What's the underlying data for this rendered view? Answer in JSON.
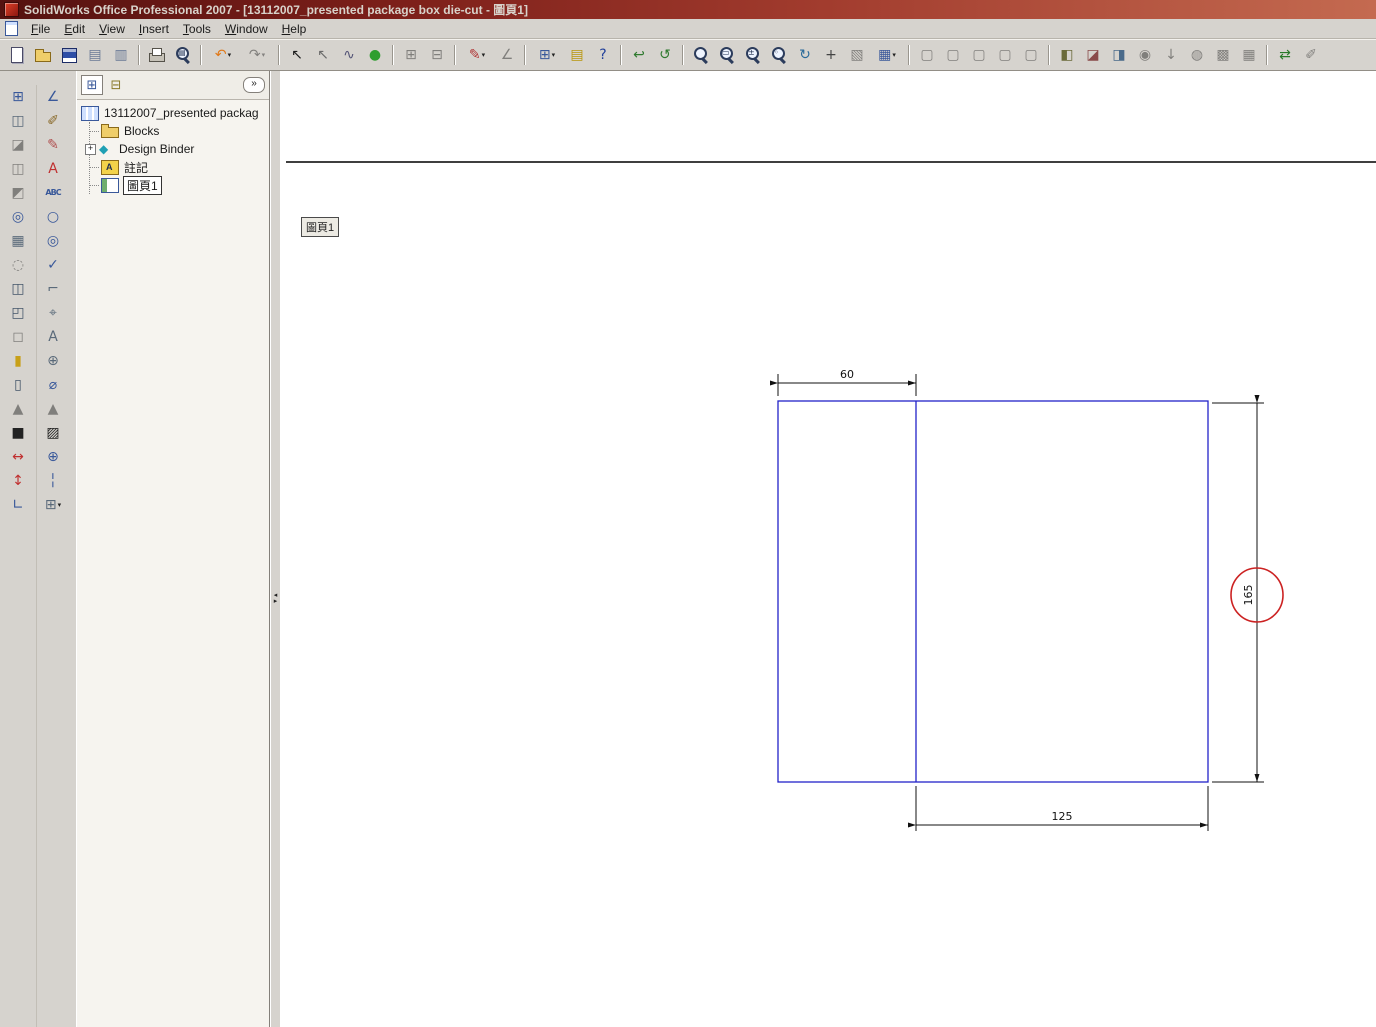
{
  "titlebar": {
    "title": "SolidWorks Office Professional 2007 - [13112007_presented package box die-cut - 圖頁1]"
  },
  "menu": {
    "items": [
      "File",
      "Edit",
      "View",
      "Insert",
      "Tools",
      "Window",
      "Help"
    ]
  },
  "ui": {
    "dropdown_glyph": "▾",
    "panel_more": "»",
    "tab_feature_glyph": "⊞",
    "tab_property_glyph": "⊟",
    "splitter_left": "◂",
    "splitter_right": "▸",
    "expander_plus": "+"
  },
  "toolbars": {
    "main": [
      {
        "name": "new-document-button",
        "shape": "page"
      },
      {
        "name": "open-button",
        "shape": "folder"
      },
      {
        "name": "save-button",
        "shape": "floppy"
      },
      {
        "name": "make-drawing-from-part-button",
        "glyph": "▤",
        "color": "#6a7a96"
      },
      {
        "name": "make-assembly-from-part-button",
        "glyph": "▥",
        "color": "#6a7a96"
      },
      {
        "sep": true
      },
      {
        "name": "print-button",
        "shape": "printer"
      },
      {
        "name": "print-preview-button",
        "shape": "mag",
        "sub": "▤"
      },
      {
        "sep": true
      },
      {
        "name": "undo-button",
        "glyph": "↶",
        "color": "#e07818",
        "dropdown": true
      },
      {
        "name": "redo-button",
        "glyph": "↷",
        "enabled": false,
        "dropdown": true
      },
      {
        "sep": true
      },
      {
        "name": "select-button",
        "glyph": "↖",
        "color": "#1a1a1a"
      },
      {
        "name": "select-other-button",
        "glyph": "↖",
        "color": "#6a6a6a"
      },
      {
        "name": "lasso-select-button",
        "glyph": "∿",
        "color": "#555577"
      },
      {
        "name": "selection-filter-button",
        "glyph": "●",
        "color": "#2f9e2f"
      },
      {
        "sep": true
      },
      {
        "name": "grid-settings-button",
        "glyph": "⊞",
        "enabled": false
      },
      {
        "name": "snap-settings-button",
        "glyph": "⊟",
        "enabled": false
      },
      {
        "sep": true
      },
      {
        "name": "sketch-button",
        "glyph": "✎",
        "color": "#b03838",
        "dropdown": true
      },
      {
        "name": "smart-dimension-button",
        "glyph": "∠",
        "enabled": false
      },
      {
        "sep": true
      },
      {
        "name": "tables-button",
        "glyph": "⊞",
        "color": "#39589a",
        "dropdown": true
      },
      {
        "name": "note-button",
        "glyph": "▤",
        "color": "#b8960c"
      },
      {
        "name": "help-button",
        "glyph": "?",
        "color": "#22409a"
      },
      {
        "sep": true
      },
      {
        "name": "undo-view-button",
        "glyph": "↩",
        "color": "#2f7a2f"
      },
      {
        "name": "redraw-button",
        "glyph": "↺",
        "color": "#2f7a2f"
      },
      {
        "sep": true
      },
      {
        "name": "zoom-to-fit-button",
        "shape": "mag"
      },
      {
        "name": "zoom-to-area-button",
        "shape": "mag",
        "sub": "▭"
      },
      {
        "name": "zoom-in-out-button",
        "shape": "mag",
        "sub": "±"
      },
      {
        "name": "zoom-to-selection-button",
        "shape": "mag",
        "sub": "◦"
      },
      {
        "name": "rotate-view-button",
        "glyph": "↻",
        "color": "#2a6a9a"
      },
      {
        "name": "pan-button",
        "glyph": "+",
        "color": "#444444"
      },
      {
        "name": "3d-drawing-view-button",
        "glyph": "▧",
        "enabled": false
      },
      {
        "name": "view-orientation-button",
        "glyph": "▦",
        "color": "#39589a",
        "dropdown": true
      },
      {
        "sep": true
      },
      {
        "name": "wireframe-button",
        "glyph": "▢",
        "enabled": false
      },
      {
        "name": "hidden-lines-visible-button",
        "glyph": "▢",
        "enabled": false
      },
      {
        "name": "hidden-lines-removed-button",
        "glyph": "▢",
        "enabled": false
      },
      {
        "name": "shaded-with-edges-button",
        "glyph": "▢",
        "enabled": false
      },
      {
        "name": "shaded-button",
        "glyph": "▢",
        "enabled": false
      },
      {
        "sep": true
      },
      {
        "name": "shadows-button",
        "glyph": "◧",
        "color": "#6a6a3a"
      },
      {
        "name": "section-view-display-button",
        "glyph": "◪",
        "color": "#8a4a4a"
      },
      {
        "name": "curvature-button",
        "glyph": "◨",
        "color": "#4a6a8a"
      },
      {
        "name": "camera-view-button",
        "glyph": "◉",
        "enabled": false
      },
      {
        "name": "apply-scene-button",
        "glyph": "↓",
        "enabled": false
      },
      {
        "name": "realview-button",
        "glyph": "◍",
        "enabled": false
      },
      {
        "name": "draft-quality-button",
        "glyph": "▩",
        "enabled": false
      },
      {
        "name": "large-assembly-mode-button",
        "glyph": "▦",
        "enabled": false
      },
      {
        "sep": true
      },
      {
        "name": "hyperlink-button",
        "glyph": "⇄",
        "color": "#2a7a2a"
      },
      {
        "name": "comment-button",
        "glyph": "✐",
        "enabled": false
      }
    ],
    "left1": [
      {
        "name": "model-view-button",
        "glyph": "⊞",
        "color": "#39589a"
      },
      {
        "name": "projected-view-button",
        "glyph": "◫",
        "color": "#5a6a7a"
      },
      {
        "name": "auxiliary-view-button",
        "glyph": "◪",
        "enabled": false
      },
      {
        "name": "section-view-button",
        "glyph": "◫",
        "enabled": false
      },
      {
        "name": "aligned-section-view-button",
        "glyph": "◩",
        "enabled": false
      },
      {
        "name": "detail-view-button",
        "glyph": "◎",
        "color": "#39589a"
      },
      {
        "name": "standard-3-view-button",
        "glyph": "▦",
        "color": "#5a6a7a"
      },
      {
        "name": "broken-out-section-button",
        "glyph": "◌",
        "enabled": false
      },
      {
        "name": "break-view-button",
        "glyph": "◫",
        "color": "#44566a"
      },
      {
        "name": "crop-view-button",
        "glyph": "◰",
        "color": "#44566a"
      },
      {
        "name": "alternate-position-view-button",
        "glyph": "◻",
        "enabled": false
      },
      {
        "name": "update-view-button",
        "glyph": "▮",
        "color": "#c8a018"
      },
      {
        "name": "empty-view-button",
        "glyph": "▯",
        "color": "#44566a"
      },
      {
        "name": "rebuild-warning-icon",
        "glyph": "▲",
        "enabled": false
      },
      {
        "name": "area-fill-button",
        "glyph": "■",
        "color": "#222222"
      },
      {
        "name": "horizontal-dimension-button",
        "glyph": "↔",
        "color": "#c03030"
      },
      {
        "name": "vertical-dimension-button",
        "glyph": "↕",
        "color": "#c03030"
      },
      {
        "name": "ordinate-dimension-button",
        "glyph": "∟",
        "color": "#39589a"
      }
    ],
    "left2": [
      {
        "name": "smart-dimension-button",
        "glyph": "∠",
        "color": "#39589a"
      },
      {
        "name": "format-painter-button",
        "glyph": "✐",
        "color": "#8a6a2a"
      },
      {
        "name": "dimension-style-button",
        "glyph": "✎",
        "color": "#b05050"
      },
      {
        "name": "note-button",
        "glyph": "A",
        "color": "#c03030"
      },
      {
        "name": "spell-checker-button",
        "glyph": "ABC",
        "color": "#39589a"
      },
      {
        "name": "balloon-button",
        "glyph": "○",
        "color": "#39589a"
      },
      {
        "name": "auto-balloon-button",
        "glyph": "◎",
        "color": "#39589a"
      },
      {
        "name": "surface-finish-button",
        "glyph": "✓",
        "color": "#39589a"
      },
      {
        "name": "weld-symbol-button",
        "glyph": "⌐",
        "color": "#5a6a7a"
      },
      {
        "name": "geometric-tolerance-button",
        "glyph": "⌖",
        "color": "#5a6a7a"
      },
      {
        "name": "datum-feature-button",
        "glyph": "A",
        "color": "#5a6a7a"
      },
      {
        "name": "datum-target-button",
        "glyph": "⊕",
        "color": "#5a6a7a"
      },
      {
        "name": "hole-callout-button",
        "glyph": "⌀",
        "color": "#39589a"
      },
      {
        "name": "revision-symbol-button",
        "glyph": "▲",
        "enabled": false
      },
      {
        "name": "area-hatch-button",
        "glyph": "▨",
        "color": "#222222"
      },
      {
        "name": "center-mark-button",
        "glyph": "⊕",
        "color": "#39589a"
      },
      {
        "name": "centerline-button",
        "glyph": "╎",
        "color": "#39589a"
      },
      {
        "name": "tables-button",
        "glyph": "⊞",
        "color": "#5a6a7a",
        "dropdown": true
      }
    ]
  },
  "tree": {
    "root_label": "13112007_presented packag",
    "items": {
      "blocks": "Blocks",
      "design_binder": "Design Binder",
      "annotations": "註記",
      "sheet": "圖頁1"
    }
  },
  "drawing": {
    "sheet_label": "圖頁1",
    "dim_top": "60",
    "dim_right": "165",
    "dim_bottom": "125"
  }
}
